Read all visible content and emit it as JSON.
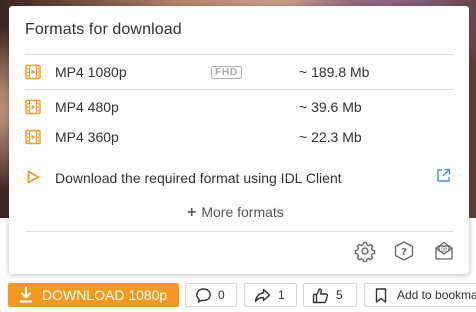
{
  "popup": {
    "title": "Formats for download",
    "formats": [
      {
        "name": "MP4 1080p",
        "badge": "FHD",
        "size": "~ 189.8 Mb"
      },
      {
        "name": "MP4 480p",
        "badge": "",
        "size": "~ 39.6 Mb"
      },
      {
        "name": "MP4 360p",
        "badge": "",
        "size": "~ 22.3 Mb"
      }
    ],
    "idl_text": "Download the required format using IDL Client",
    "more_formats": "More formats",
    "footer_icons": [
      "settings-icon",
      "help-icon",
      "mail-icon"
    ]
  },
  "actions": {
    "download_label": "DOWNLOAD 1080p",
    "comments_count": "0",
    "shares_count": "1",
    "likes_count": "5",
    "bookmark_label": "Add to bookmarks"
  },
  "colors": {
    "accent": "#f59a21",
    "link_icon": "#4a90d9",
    "text": "#333333",
    "divider": "#dcdcdc"
  }
}
